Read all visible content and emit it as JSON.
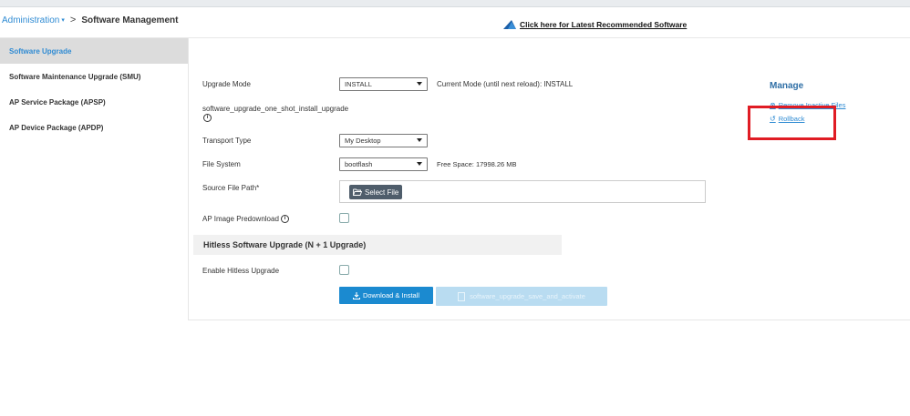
{
  "breadcrumb": {
    "parent": "Administration",
    "separator": ">",
    "current": "Software Management"
  },
  "header": {
    "latest_link": "Click here for Latest Recommended Software"
  },
  "sidebar": {
    "items": [
      {
        "label": "Software Upgrade",
        "active": true
      },
      {
        "label": "Software Maintenance Upgrade (SMU)",
        "active": false
      },
      {
        "label": "AP Service Package (APSP)",
        "active": false
      },
      {
        "label": "AP Device Package (APDP)",
        "active": false
      }
    ]
  },
  "form": {
    "upgrade_mode_label": "Upgrade Mode",
    "upgrade_mode_value": "INSTALL",
    "current_mode_text": "Current Mode (until next reload): INSTALL",
    "one_shot_label": "software_upgrade_one_shot_install_upgrade",
    "transport_type_label": "Transport Type",
    "transport_type_value": "My Desktop",
    "file_system_label": "File System",
    "file_system_value": "bootflash",
    "free_space_text": "Free Space: 17998.26 MB",
    "source_path_label": "Source File Path*",
    "select_file_label": "Select File",
    "ap_predownload_label": "AP Image Predownload",
    "hitless_section_title": "Hitless Software Upgrade (N + 1 Upgrade)",
    "enable_hitless_label": "Enable Hitless Upgrade",
    "download_install_label": "Download & Install",
    "save_activate_label": "software_upgrade_save_and_activate"
  },
  "manage": {
    "title": "Manage",
    "remove_inactive_label": "Remove Inactive Files",
    "rollback_label": "Rollback"
  },
  "colors": {
    "accent": "#2f8bd3",
    "primary_button": "#1b8ad0",
    "disabled_button": "#b9dcf1",
    "highlight_box": "#e01c24"
  }
}
